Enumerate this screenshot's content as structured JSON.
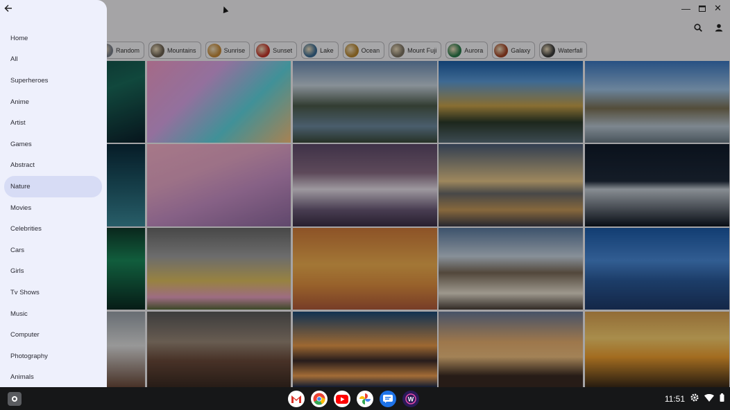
{
  "window": {
    "controls": [
      "minimize-icon",
      "maximize-icon",
      "close-icon"
    ]
  },
  "toolbar": {
    "icons": [
      "search-icon",
      "account-icon"
    ]
  },
  "chips": [
    {
      "label": "Random",
      "color": "#7a7f8a"
    },
    {
      "label": "Mountains",
      "color": "#6b6152"
    },
    {
      "label": "Sunrise",
      "color": "#c48a3a"
    },
    {
      "label": "Sunset",
      "color": "#c3352b"
    },
    {
      "label": "Lake",
      "color": "#3a6b92"
    },
    {
      "label": "Ocean",
      "color": "#b58530"
    },
    {
      "label": "Mount Fuji",
      "color": "#7d7464"
    },
    {
      "label": "Aurora",
      "color": "#2a7a4a"
    },
    {
      "label": "Galaxy",
      "color": "#a14426"
    },
    {
      "label": "Waterfall",
      "color": "#3b3b3b"
    }
  ],
  "drawer": {
    "items": [
      {
        "label": "Home"
      },
      {
        "label": "All"
      },
      {
        "label": "Superheroes"
      },
      {
        "label": "Anime"
      },
      {
        "label": "Artist"
      },
      {
        "label": "Games"
      },
      {
        "label": "Abstract"
      },
      {
        "label": "Nature",
        "active": true
      },
      {
        "label": "Movies"
      },
      {
        "label": "Celebrities"
      },
      {
        "label": "Cars"
      },
      {
        "label": "Girls"
      },
      {
        "label": "Tv Shows"
      },
      {
        "label": "Music"
      },
      {
        "label": "Computer"
      },
      {
        "label": "Photography"
      },
      {
        "label": "Animals"
      }
    ]
  },
  "wallpapers": [
    [
      "linear-gradient(160deg,#0e3a3a,#1a6a5a 50%,#0b1f2b)",
      "linear-gradient(135deg,#f39cc7,#d9a6e8 35%,#5fd6e0 65%,#f7c07a)",
      "linear-gradient(180deg,#6b8db5,#c8d4de 30%,#4b5a4a 55%,#6d8aa0 80%,#3a4a3a)",
      "linear-gradient(180deg,#1c5fa8,#5c9bd8 25%,#c9a24a 55%,#2b3a2a 75%,#5a6f7a)",
      "linear-gradient(180deg,#3b78c2,#9ec2e4 35%,#7c7256 58%,#b9c7d3 80%,#6b7b86)"
    ],
    [
      "linear-gradient(180deg,#0a2a3a,#1f5a6a 50%,#3b8a9a)",
      "linear-gradient(160deg,#f6b2c9,#e6a7c8 35%,#c790c6 60%,#8e6aa0)",
      "linear-gradient(180deg,#5d4a6a,#8a6d85 35%,#e8e0ea 55%,#6b5a78 80%,#3a2e45)",
      "linear-gradient(180deg,#4a5d78,#e8c88a 45%,#6a6a6a 60%,#c69a5a 80%,#3a3a48)",
      "linear-gradient(180deg,#101a2a,#1e2a3a 45%,#c8d0d8 55%,#0c1420)"
    ],
    [
      "linear-gradient(180deg,#0f3a2a,#1a8a5a 40%,#0a2a22)",
      "linear-gradient(180deg,#6a6a6a,#a0a0a0 35%,#e0c060 65%,#e8a0c0 85%,#5a6a3a)",
      "linear-gradient(180deg,#d07a3a,#f0b050 45%,#e09040 70%,#b05a3a)",
      "linear-gradient(180deg,#5a7aa0,#c8d4e0 35%,#7a6a58 55%,#e8e0d0 80%,#4a4038)",
      "linear-gradient(180deg,#1a5aa8,#4a8ad8 40%,#2a5a9a 65%,#1e3a6a)"
    ],
    [
      "linear-gradient(180deg,#9aa2aa,#e0e0e0 45%,#6a4a3a)",
      "linear-gradient(180deg,#5a5a5a,#9a8878 40%,#6a4a3a 65%,#3a2a22)",
      "linear-gradient(180deg,#1a4a7a,#e89a4a 45%,#3a2a2a 65%,#f0a050 85%,#1a2a4a)",
      "linear-gradient(180deg,#6a7a9a,#e8b070 40%,#f0c080 60%,#3a2a22 85%)",
      "linear-gradient(180deg,#d8a050,#f8d070 35%,#f0a030 60%,#3a2a18)"
    ]
  ],
  "shelf": {
    "apps": [
      {
        "icon": "gmail-icon",
        "color": "#ffffff"
      },
      {
        "icon": "chrome-icon",
        "color": "#ffffff"
      },
      {
        "icon": "youtube-icon",
        "color": "#ffffff"
      },
      {
        "icon": "photos-icon",
        "color": "#ffffff"
      },
      {
        "icon": "messages-icon",
        "color": "#1e73e8"
      },
      {
        "icon": "wallpaper-app-icon",
        "color": "#2a1a5a"
      }
    ],
    "time": "11:51"
  }
}
